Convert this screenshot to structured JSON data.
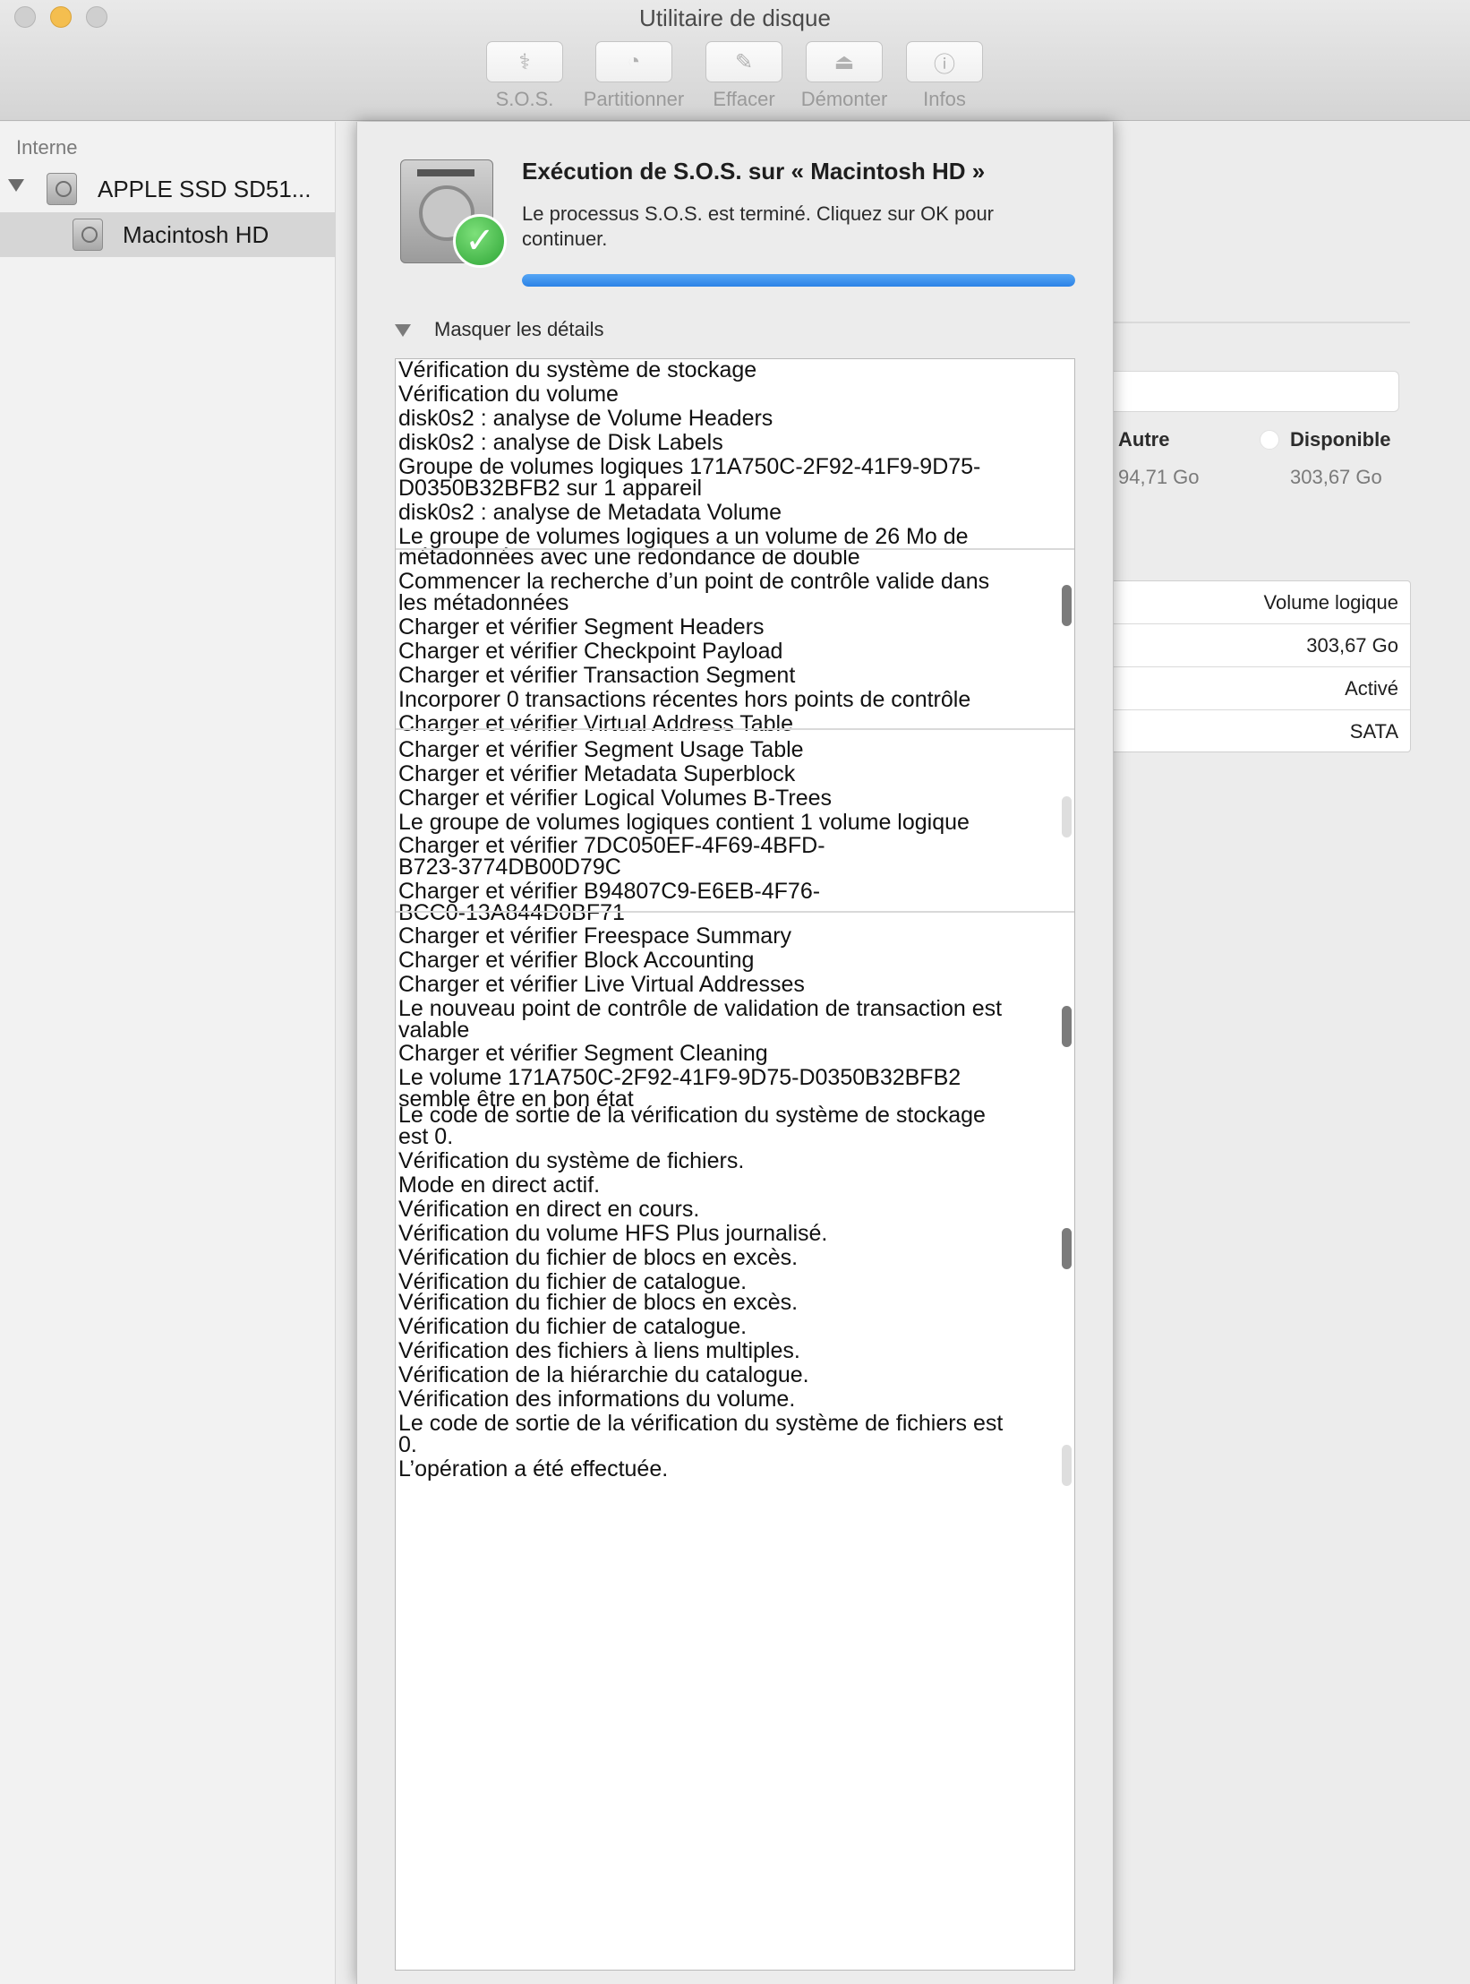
{
  "window": {
    "title": "Utilitaire de disque"
  },
  "toolbar": [
    {
      "label": "S.O.S.",
      "icon": "stethoscope-icon",
      "glyph": "⚕"
    },
    {
      "label": "Partitionner",
      "icon": "pie-chart-icon",
      "glyph": "◔"
    },
    {
      "label": "Effacer",
      "icon": "eraser-icon",
      "glyph": "✎"
    },
    {
      "label": "Démonter",
      "icon": "eject-icon",
      "glyph": "⏏"
    },
    {
      "label": "Infos",
      "icon": "info-icon",
      "glyph": "ⓘ"
    }
  ],
  "sidebar": {
    "section": "Interne",
    "disk": {
      "label": "APPLE SSD SD51..."
    },
    "volume": {
      "label": "Macintosh HD"
    }
  },
  "sheet": {
    "title": "Exécution de S.O.S. sur « Macintosh HD »",
    "message": "Le processus S.O.S. est terminé. Cliquez sur OK pour continuer.",
    "progress": 1.0,
    "details_toggle": "Masquer les détails",
    "log": [
      "Vérification du système de stockage",
      "Vérification du volume",
      "disk0s2 : analyse de Volume Headers",
      "disk0s2 : analyse de Disk Labels",
      "Groupe de volumes logiques 171A750C-2F92-41F9-9D75-\nD0350B32BFB2 sur 1 appareil",
      "disk0s2 : analyse de Metadata Volume",
      "Le groupe de volumes logiques a un volume de 26 Mo de",
      "métadonnées avec une redondance de double",
      "Commencer la recherche d’un point de contrôle valide dans\nles métadonnées",
      "Charger et vérifier Segment Headers",
      "Charger et vérifier Checkpoint Payload",
      "Charger et vérifier Transaction Segment",
      "Incorporer 0 transactions récentes hors points de contrôle",
      "Charger et vérifier Virtual Address Table",
      "Charger et vérifier Segment Usage Table",
      "Charger et vérifier Metadata Superblock",
      "Charger et vérifier Logical Volumes B-Trees",
      "Le groupe de volumes logiques contient 1 volume logique",
      "Charger et vérifier 7DC050EF-4F69-4BFD-\nB723-3774DB00D79C",
      "Charger et vérifier B94807C9-E6EB-4F76-\nBCC0-13A844D0BF71",
      "Charger et vérifier Freespace Summary",
      "Charger et vérifier Block Accounting",
      "Charger et vérifier Live Virtual Addresses",
      "Le nouveau point de contrôle de validation de transaction est\nvalable",
      "Charger et vérifier Segment Cleaning",
      "Le volume 171A750C-2F92-41F9-9D75-D0350B32BFB2",
      "semble être en bon état",
      "Le code de sortie de la vérification du système de stockage\nest 0.",
      "Vérification du système de fichiers.",
      "Mode en direct actif.",
      "Vérification en direct en cours.",
      "Vérification du volume HFS Plus journalisé.",
      "Vérification du fichier de blocs en excès.",
      "Vérification du fichier de catalogue.",
      "Vérification du fichier de blocs en excès.",
      "Vérification du fichier de catalogue.",
      "Vérification des fichiers à liens multiples.",
      "Vérification de la hiérarchie du catalogue.",
      "Vérification des informations du volume.",
      "Le code de sortie de la vérification du système de fichiers est\n0.",
      "L’opération a été effectuée."
    ]
  },
  "background": {
    "legend": [
      {
        "label": "Autre",
        "value": "94,71 Go"
      },
      {
        "label": "Disponible",
        "value": "303,67 Go"
      }
    ],
    "info_rows": [
      "Volume logique",
      "303,67 Go",
      "Activé",
      "SATA"
    ]
  }
}
